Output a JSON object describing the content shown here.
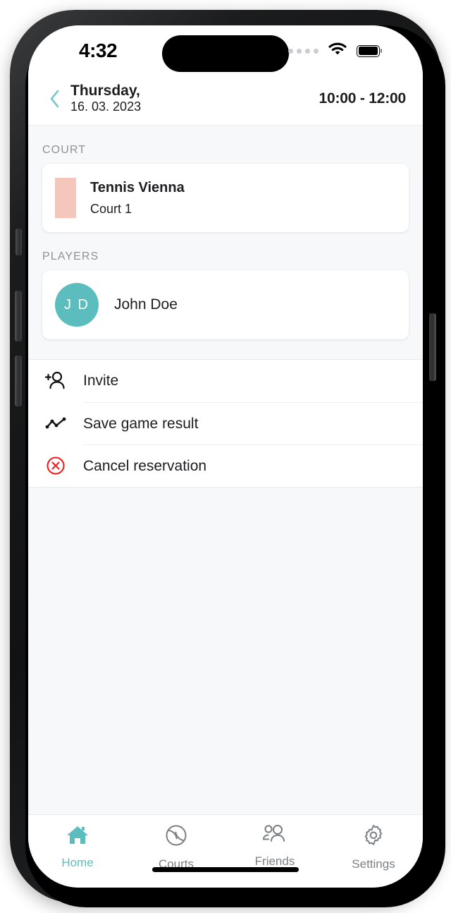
{
  "status_bar": {
    "time": "4:32",
    "cellular_icon": "cellular-dots-icon",
    "wifi_icon": "wifi-icon",
    "battery_icon": "battery-full-icon"
  },
  "header": {
    "back_icon": "chevron-left-icon",
    "weekday": "Thursday,",
    "date": "16. 03. 2023",
    "time_range": "10:00 - 12:00"
  },
  "court_section": {
    "label": "COURT",
    "thumbnail": "court-thumbnail",
    "name": "Tennis Vienna",
    "court": "Court 1"
  },
  "players_section": {
    "label": "PLAYERS",
    "players": [
      {
        "initials": "J D",
        "name": "John Doe"
      }
    ]
  },
  "actions": [
    {
      "icon": "person-add-icon",
      "label": "Invite"
    },
    {
      "icon": "trend-line-icon",
      "label": "Save game result"
    },
    {
      "icon": "cancel-circle-icon",
      "label": "Cancel reservation"
    }
  ],
  "tab_bar": {
    "items": [
      {
        "icon": "home-icon",
        "label": "Home",
        "active": true
      },
      {
        "icon": "tennis-ball-icon",
        "label": "Courts",
        "active": false
      },
      {
        "icon": "friends-icon",
        "label": "Friends",
        "active": false
      },
      {
        "icon": "gear-icon",
        "label": "Settings",
        "active": false
      }
    ]
  },
  "colors": {
    "accent_teal": "#5cbdbe",
    "danger_red": "#f01f1f",
    "court_thumb_pink": "#f4c6bc",
    "page_background": "#f7f8f9",
    "text_primary": "#1b1d1f",
    "text_muted": "#8e9396"
  }
}
